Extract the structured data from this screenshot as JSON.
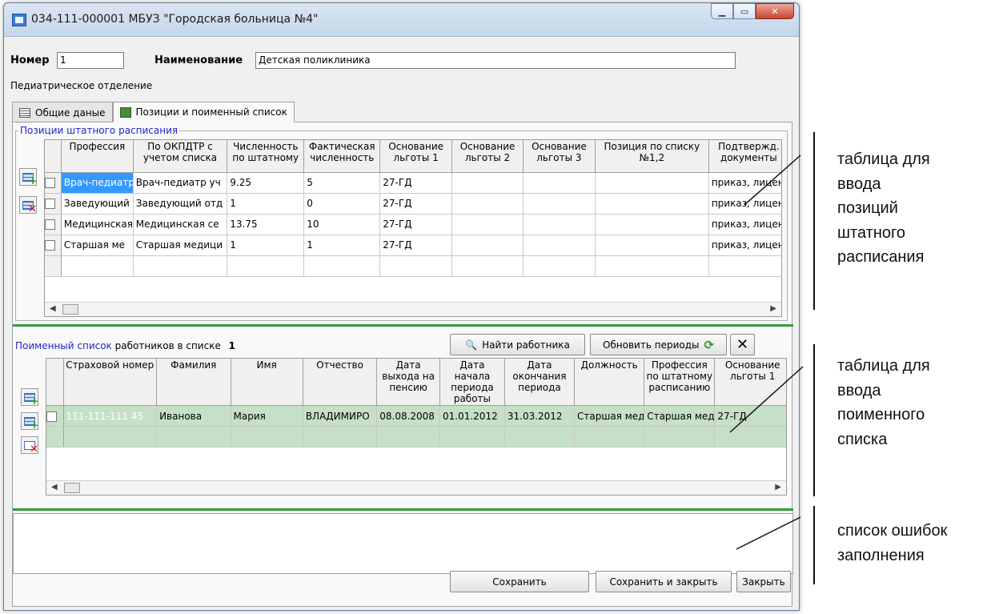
{
  "window": {
    "title": "034-111-000001 МБУЗ  \"Городская больница №4\""
  },
  "header": {
    "nomer_label": "Номер",
    "nomer_value": "1",
    "name_label": "Наименование",
    "name_value": "Детская поликлиника",
    "department": "Педиатрическое отделение"
  },
  "tabs": [
    {
      "label": "Общие даные"
    },
    {
      "label": "Позиции и поименный список"
    }
  ],
  "positions": {
    "title": "Позиции штатного расписания",
    "columns": [
      "Профессия",
      "По ОКПДТР с учетом списка",
      "Численность по штатному",
      "Фактическая численность",
      "Основание льготы 1",
      "Основание льготы 2",
      "Основание льготы 3",
      "Позиция по списку №1,2",
      "Подтвержд. документы"
    ],
    "rows": [
      [
        "Врач-педиатр",
        "Врач-педиатр уч",
        "9.25",
        "5",
        "27-ГД",
        "",
        "",
        "",
        "приказ, лицен"
      ],
      [
        "Заведующий",
        "Заведующий отд",
        "1",
        "0",
        "27-ГД",
        "",
        "",
        "",
        "приказ, лицен"
      ],
      [
        "Медицинская",
        "Медицинская се",
        "13.75",
        "10",
        "27-ГД",
        "",
        "",
        "",
        "приказ, лицен"
      ],
      [
        "Старшая ме",
        "Старшая медици",
        "1",
        "1",
        "27-ГД",
        "",
        "",
        "",
        "приказ, лицен"
      ]
    ]
  },
  "named_list": {
    "title": "Поименный список",
    "count_label": "работников в списке",
    "count": "1",
    "find_button": "Найти работника",
    "refresh_button": "Обновить периоды",
    "columns": [
      "Страховой номер",
      "Фамилия",
      "Имя",
      "Отчество",
      "Дата выхода на пенсию",
      "Дата начала периода работы",
      "Дата окончания периода",
      "Должность",
      "Профессия по штатному расписанию",
      "Основание льготы 1"
    ],
    "rows": [
      [
        "111-111-111 45",
        "Иванова",
        "Мария",
        "ВЛАДИМИРО",
        "08.08.2008",
        "01.01.2012",
        "31.03.2012",
        "Старшая мед",
        "Старшая мед",
        "27-ГД"
      ]
    ]
  },
  "footer": {
    "save": "Сохранить",
    "save_close": "Сохранить и закрыть",
    "close": "Закрыть"
  },
  "annotations": {
    "positions_table": [
      "таблица для",
      "ввода",
      "позиций",
      "штатного",
      "расписания"
    ],
    "named_table": [
      "таблица для",
      "ввода",
      "поименного",
      "списка"
    ],
    "errors_list": [
      "список ошибок",
      "заполнения"
    ]
  }
}
